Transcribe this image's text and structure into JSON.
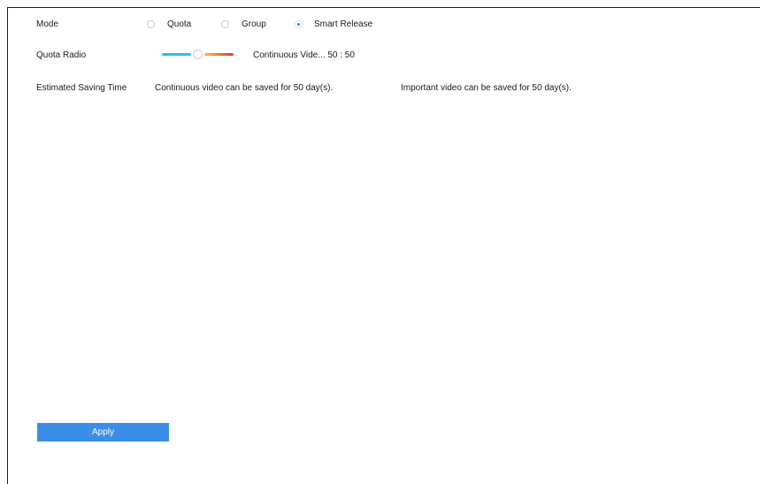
{
  "mode": {
    "label": "Mode",
    "options": [
      {
        "label": "Quota",
        "selected": false
      },
      {
        "label": "Group",
        "selected": false
      },
      {
        "label": "Smart Release",
        "selected": true
      }
    ]
  },
  "quota_radio": {
    "label": "Quota Radio",
    "slider_fraction": 0.5,
    "value_text": "Continuous Vide... 50 :  50",
    "colors": {
      "left_track": "#1fc7d4",
      "right_track": "#ef7a2c"
    }
  },
  "estimated_saving": {
    "label": "Estimated Saving Time",
    "continuous_text": "Continuous video can be saved for 50 day(s).",
    "important_text": "Important video can be saved for 50 day(s)."
  },
  "apply_button": {
    "label": "Apply",
    "color": "#3a8ee8"
  }
}
